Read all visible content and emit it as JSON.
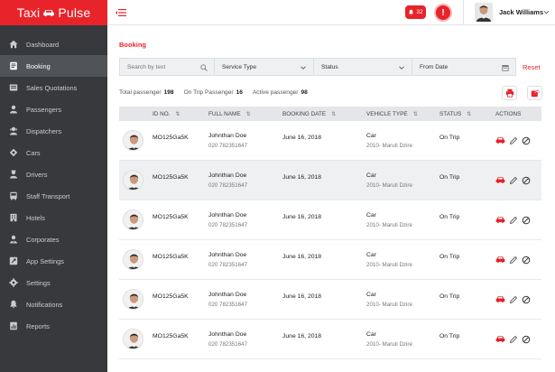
{
  "brand": {
    "word1": "Taxi",
    "word2": "Pulse"
  },
  "sidebar": {
    "items": [
      {
        "label": "Dashboard",
        "icon": "dashboard-icon",
        "active": false
      },
      {
        "label": "Booking",
        "icon": "booking-icon",
        "active": true
      },
      {
        "label": "Sales Quotations",
        "icon": "quotation-icon",
        "active": false
      },
      {
        "label": "Passengers",
        "icon": "passenger-icon",
        "active": false
      },
      {
        "label": "Dispatchers",
        "icon": "dispatcher-icon",
        "active": false
      },
      {
        "label": "Cars",
        "icon": "car-tag-icon",
        "active": false
      },
      {
        "label": "Drivers",
        "icon": "driver-icon",
        "active": false
      },
      {
        "label": "Staff Transport",
        "icon": "bus-icon",
        "active": false
      },
      {
        "label": "Hotels",
        "icon": "hotel-icon",
        "active": false
      },
      {
        "label": "Corporates",
        "icon": "corporate-icon",
        "active": false
      },
      {
        "label": "App Settings",
        "icon": "app-settings-icon",
        "active": false
      },
      {
        "label": "Settings",
        "icon": "gear-icon",
        "active": false
      },
      {
        "label": "Notifications",
        "icon": "bell-icon",
        "active": false
      },
      {
        "label": "Reports",
        "icon": "report-icon",
        "active": false
      }
    ]
  },
  "header": {
    "notification_count": "32",
    "alert_symbol": "!",
    "user_name": "Jack Williams"
  },
  "page": {
    "title": "Booking"
  },
  "filters": {
    "search_placeholder": "Search by text",
    "service_type": "Service Type",
    "status": "Status",
    "from_date": "From Date",
    "reset": "Reset"
  },
  "stats": {
    "total_label": "Total passenger",
    "total_value": "198",
    "ontrip_label": "On Trip Passenger",
    "ontrip_value": "16",
    "active_label": "Active passenger",
    "active_value": "98"
  },
  "table": {
    "headers": {
      "id": "ID NO.",
      "name": "FULL NAME",
      "date": "BOOKING DATE",
      "vehicle": "VEHICLE TYPE",
      "status": "STATUS",
      "actions": "ACTIONS"
    },
    "rows": [
      {
        "id": "MO125Ga5K",
        "name": "Johnthan Doe",
        "phone": "020 782351647",
        "date": "June 16, 2018",
        "vehicle": "Car",
        "model": "2010- Maruti Dzire",
        "status": "On Trip"
      },
      {
        "id": "MO125Ga5K",
        "name": "Johnthan Doe",
        "phone": "020 782351647",
        "date": "June 16, 2018",
        "vehicle": "Car",
        "model": "2010- Maruti Dzire",
        "status": "On Trip"
      },
      {
        "id": "MO125Ga5K",
        "name": "Johnthan Doe",
        "phone": "020 782351647",
        "date": "June 16, 2018",
        "vehicle": "Car",
        "model": "2010- Maruti Dzire",
        "status": "On Trip"
      },
      {
        "id": "MO125Ga5K",
        "name": "Johnthan Doe",
        "phone": "020 782351647",
        "date": "June 16, 2018",
        "vehicle": "Car",
        "model": "2010- Maruti Dzire",
        "status": "On Trip"
      },
      {
        "id": "MO125Ga5K",
        "name": "Johnthan Doe",
        "phone": "020 782351647",
        "date": "June 16, 2018",
        "vehicle": "Car",
        "model": "2010- Maruti Dzire",
        "status": "On Trip"
      },
      {
        "id": "MO125Ga5K",
        "name": "Johnthan Doe",
        "phone": "020 782351647",
        "date": "June 16, 2018",
        "vehicle": "Car",
        "model": "2010- Maruti Dzire",
        "status": "On Trip"
      }
    ]
  },
  "colors": {
    "accent": "#e8232a",
    "sidebar": "#37393d",
    "sidebar_active": "#505357"
  }
}
